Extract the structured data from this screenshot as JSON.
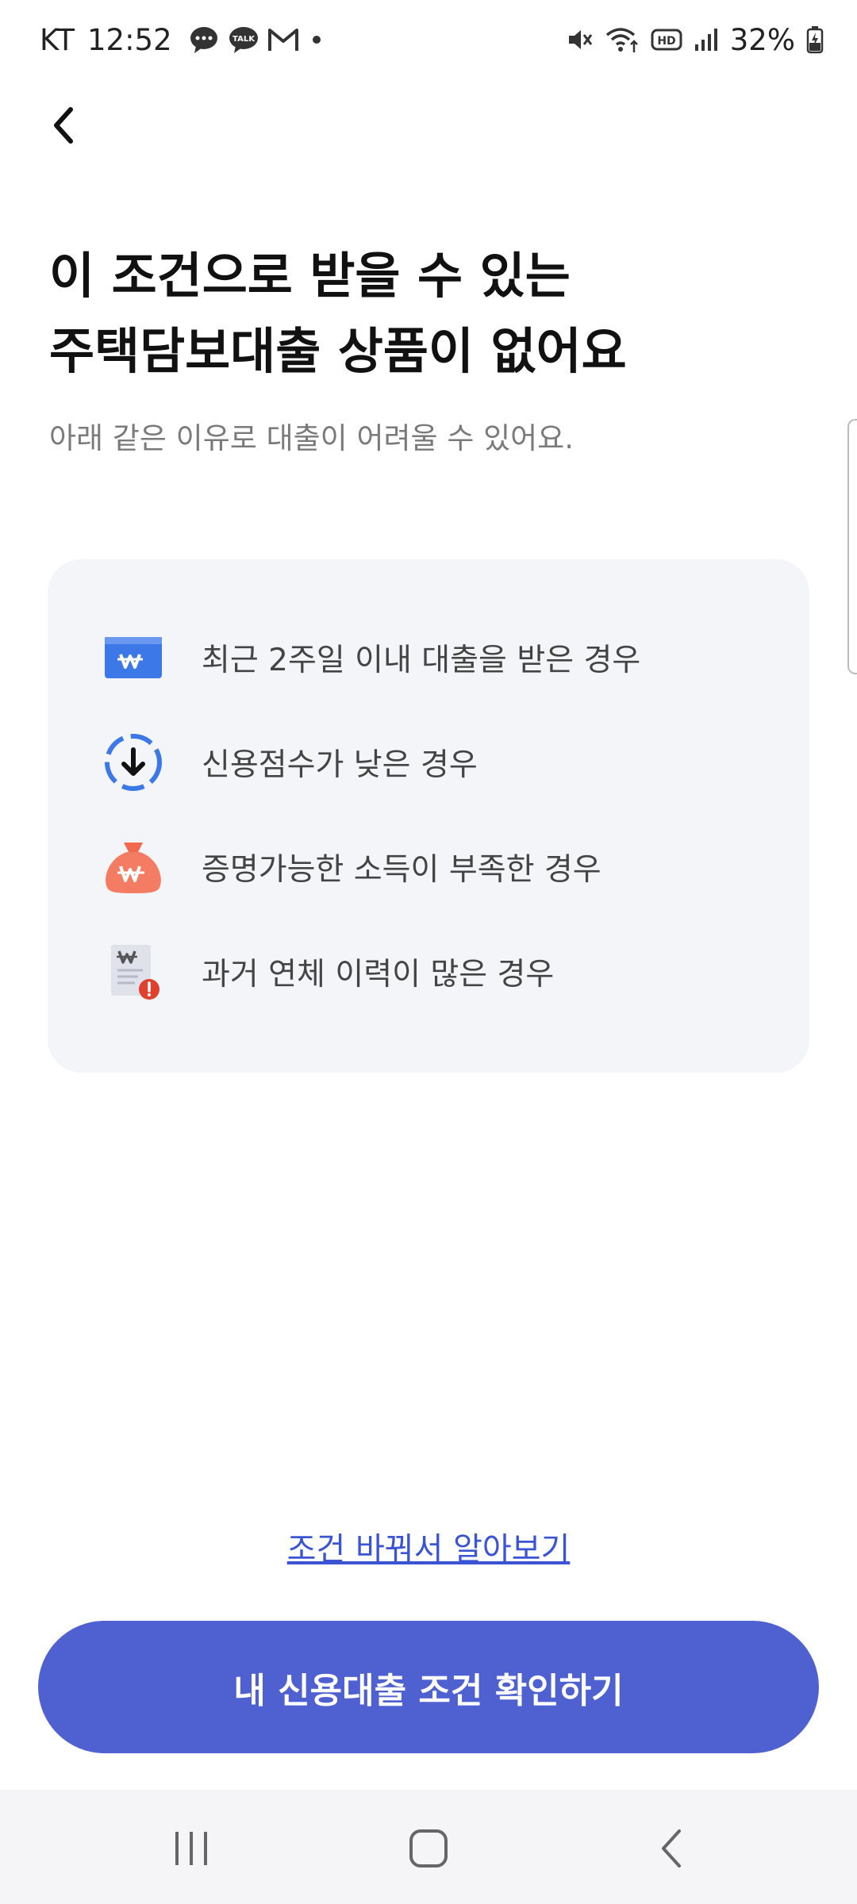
{
  "status_bar": {
    "carrier": "KT",
    "time": "12:52",
    "battery": "32%",
    "left_icons": [
      "chat-bubble-icon",
      "kakaotalk-icon",
      "gmail-icon",
      "dot-icon"
    ],
    "right_icons": [
      "mute-icon",
      "wifi-icon",
      "hd-icon",
      "signal-icon",
      "battery-icon"
    ]
  },
  "header": {
    "back_icon": "chevron-left-icon"
  },
  "title": {
    "line1": "이 조건으로 받을 수 있는",
    "line2": "주택담보대출 상품이 없어요"
  },
  "subtitle": "아래 같은 이유로 대출이 어려울 수 있어요.",
  "reasons": [
    {
      "icon": "won-card-icon",
      "text": "최근 2주일 이내 대출을 받은 경우"
    },
    {
      "icon": "score-down-icon",
      "text": "신용점수가 낮은 경우"
    },
    {
      "icon": "money-bag-icon",
      "text": "증명가능한 소득이 부족한 경우"
    },
    {
      "icon": "document-warning-icon",
      "text": "과거 연체 이력이 많은 경우"
    }
  ],
  "change_link": "조건 바꿔서 알아보기",
  "primary_button": "내 신용대출 조건 확인하기",
  "colors": {
    "primary": "#4f61d1",
    "link": "#3b54d4",
    "card_bg": "#f4f5f9",
    "subtitle": "#7a7a7a"
  },
  "nav_bar": {
    "icons": [
      "recent-apps-icon",
      "home-icon",
      "back-icon"
    ]
  }
}
